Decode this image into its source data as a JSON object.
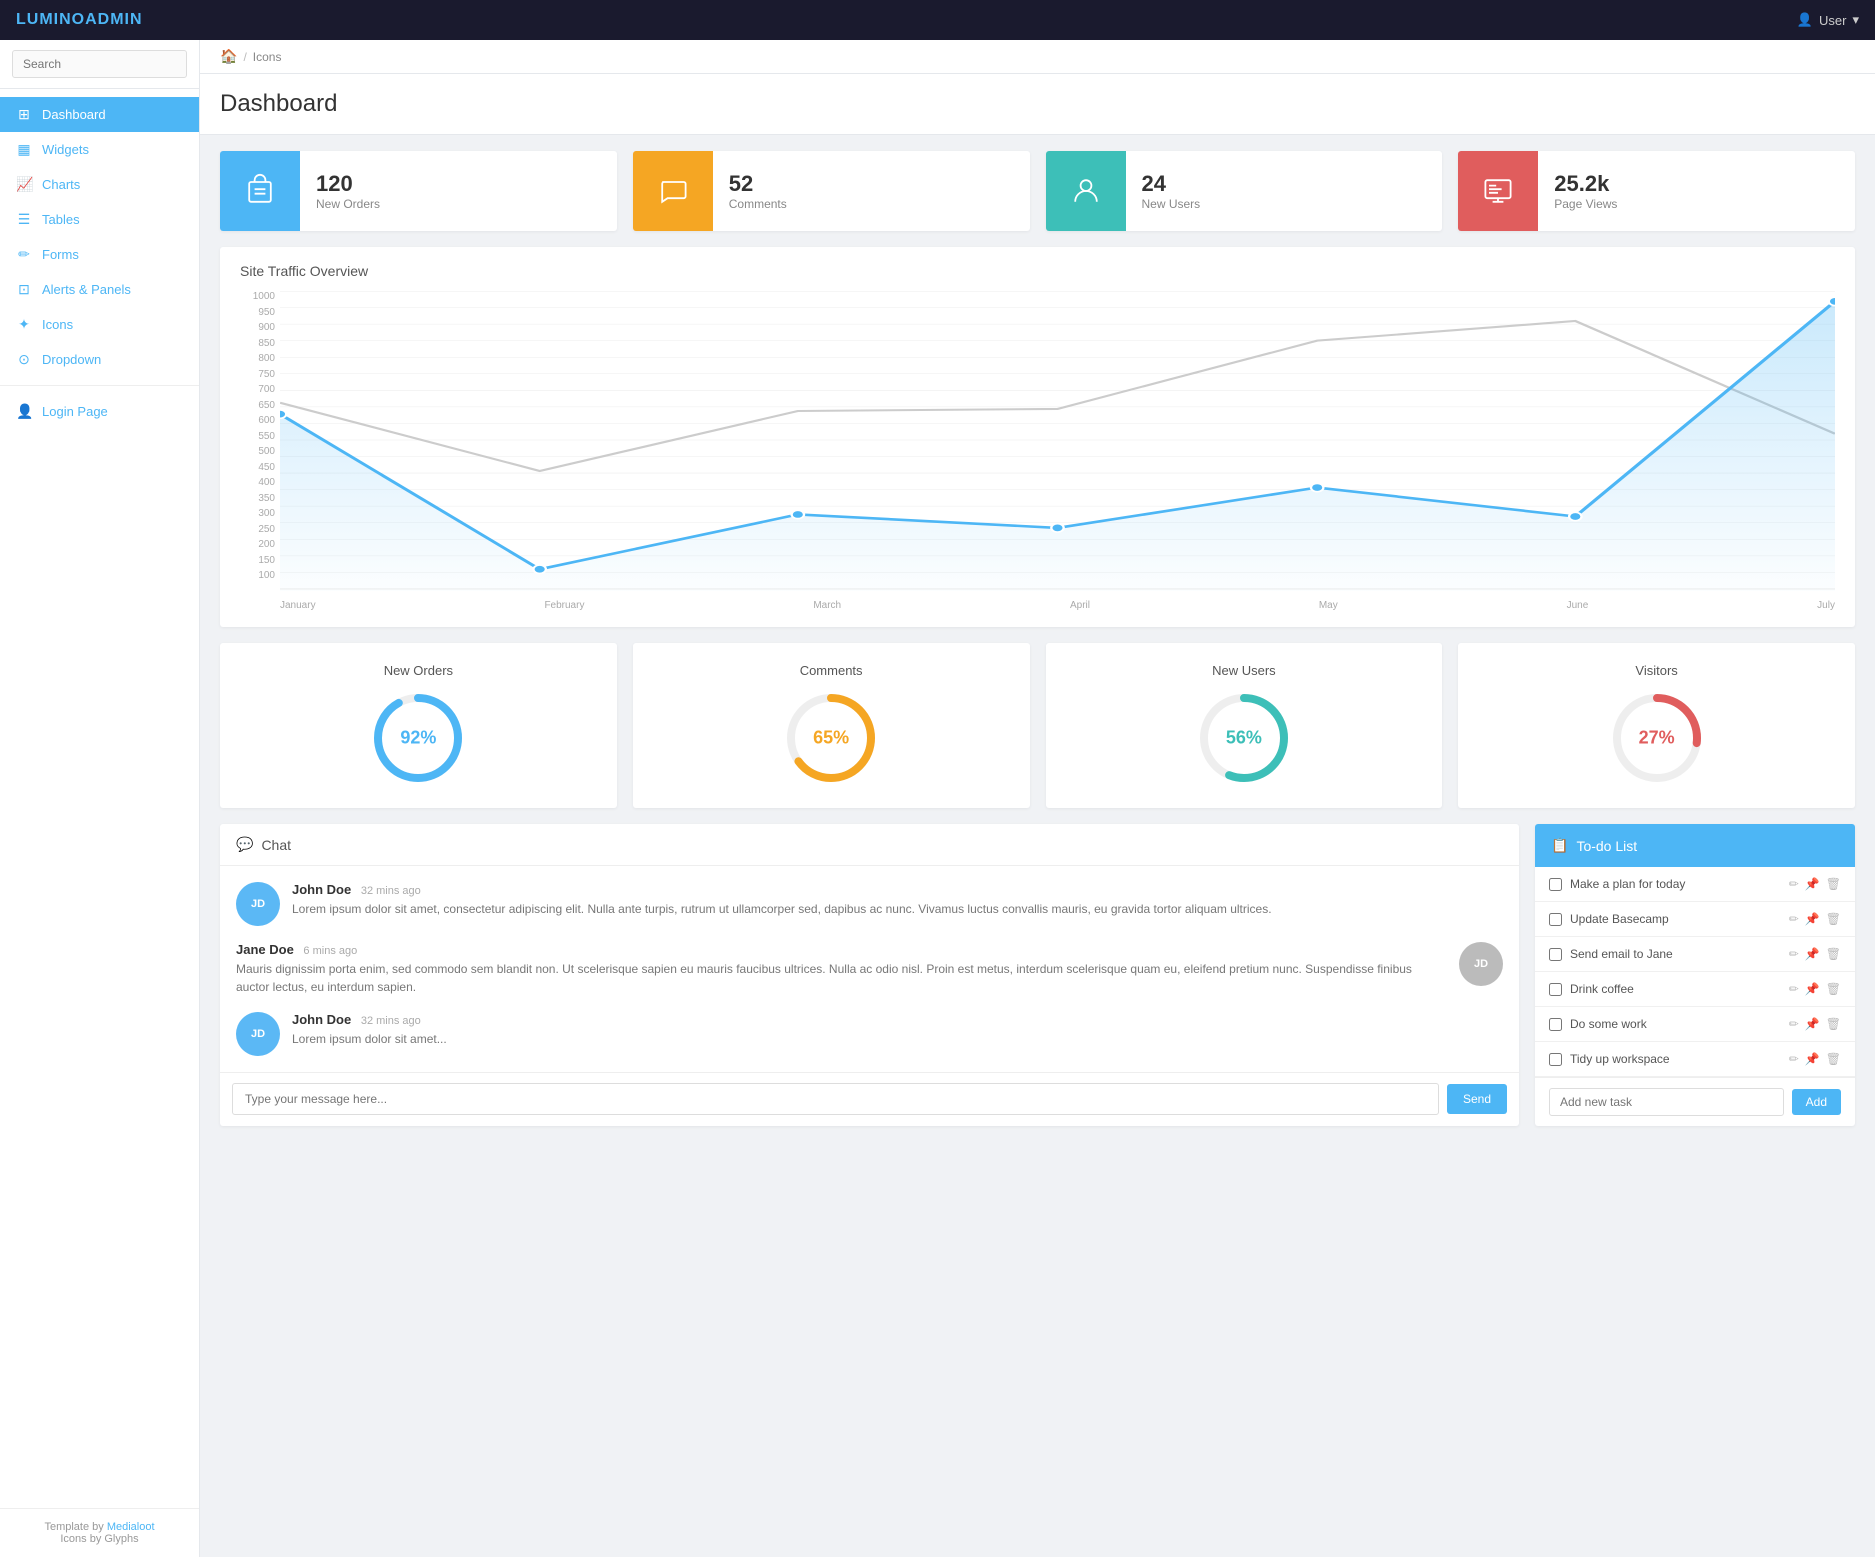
{
  "navbar": {
    "brand_prefix": "LUMINO",
    "brand_suffix": "ADMIN",
    "user_label": "User"
  },
  "sidebar": {
    "search_placeholder": "Search",
    "items": [
      {
        "id": "dashboard",
        "label": "Dashboard",
        "icon": "⊞",
        "active": true
      },
      {
        "id": "widgets",
        "label": "Widgets",
        "icon": "▦"
      },
      {
        "id": "charts",
        "label": "Charts",
        "icon": "📈"
      },
      {
        "id": "tables",
        "label": "Tables",
        "icon": "☰"
      },
      {
        "id": "forms",
        "label": "Forms",
        "icon": "✏"
      },
      {
        "id": "alerts",
        "label": "Alerts & Panels",
        "icon": "⊡"
      },
      {
        "id": "icons",
        "label": "Icons",
        "icon": "✦"
      },
      {
        "id": "dropdown",
        "label": "Dropdown",
        "icon": "⊙"
      }
    ],
    "extra_items": [
      {
        "id": "login",
        "label": "Login Page",
        "icon": "👤"
      }
    ],
    "footer_template": "Template by",
    "footer_brand": "Medialoot",
    "footer_icons": "Icons by Glyphs"
  },
  "breadcrumb": {
    "home_icon": "🏠",
    "current": "Icons"
  },
  "page": {
    "title": "Dashboard"
  },
  "stats": [
    {
      "id": "orders",
      "icon": "🛍",
      "number": "120",
      "label": "New Orders",
      "color": "#4db6f5"
    },
    {
      "id": "comments",
      "icon": "💬",
      "number": "52",
      "label": "Comments",
      "color": "#f5a623"
    },
    {
      "id": "users",
      "icon": "👤",
      "number": "24",
      "label": "New Users",
      "color": "#3dbfb8"
    },
    {
      "id": "views",
      "icon": "🖥",
      "number": "25.2k",
      "label": "Page Views",
      "color": "#e05d5d"
    }
  ],
  "chart": {
    "title": "Site Traffic Overview",
    "y_labels": [
      "1000",
      "950",
      "900",
      "850",
      "800",
      "750",
      "700",
      "650",
      "600",
      "550",
      "500",
      "450",
      "400",
      "350",
      "300",
      "250",
      "200",
      "150",
      "100"
    ],
    "x_labels": [
      "January",
      "February",
      "March",
      "April",
      "May",
      "June",
      "July"
    ]
  },
  "donuts": [
    {
      "id": "orders",
      "title": "New Orders",
      "value": 92,
      "label": "92%",
      "color": "#4db6f5"
    },
    {
      "id": "comments",
      "title": "Comments",
      "value": 65,
      "label": "65%",
      "color": "#f5a623"
    },
    {
      "id": "users",
      "title": "New Users",
      "value": 56,
      "label": "56%",
      "color": "#3dbfb8"
    },
    {
      "id": "visitors",
      "title": "Visitors",
      "value": 27,
      "label": "27%",
      "color": "#e05d5d"
    }
  ],
  "chat": {
    "title": "Chat",
    "messages": [
      {
        "id": 1,
        "name": "John Doe",
        "time": "32 mins ago",
        "avatar_text": "JD",
        "avatar_color": "#5bb8f5",
        "align": "left",
        "text": "Lorem ipsum dolor sit amet, consectetur adipiscing elit. Nulla ante turpis, rutrum ut ullamcorper sed, dapibus ac nunc. Vivamus luctus convallis mauris, eu gravida tortor aliquam ultrices."
      },
      {
        "id": 2,
        "name": "Jane Doe",
        "time": "6 mins ago",
        "avatar_text": "JD",
        "avatar_color": "#bbb",
        "align": "right",
        "text": "Mauris dignissim porta enim, sed commodo sem blandit non. Ut scelerisque sapien eu mauris faucibus ultrices. Nulla ac odio nisl. Proin est metus, interdum scelerisque quam eu, eleifend pretium nunc. Suspendisse finibus auctor lectus, eu interdum sapien."
      },
      {
        "id": 3,
        "name": "John Doe",
        "time": "32 mins ago",
        "avatar_text": "JD",
        "avatar_color": "#5bb8f5",
        "align": "left",
        "text": "Lorem ipsum dolor sit amet..."
      }
    ],
    "input_placeholder": "Type your message here...",
    "send_label": "Send"
  },
  "todo": {
    "title": "To-do List",
    "items": [
      {
        "id": 1,
        "label": "Make a plan for today",
        "checked": false
      },
      {
        "id": 2,
        "label": "Update Basecamp",
        "checked": false
      },
      {
        "id": 3,
        "label": "Send email to Jane",
        "checked": false
      },
      {
        "id": 4,
        "label": "Drink coffee",
        "checked": false
      },
      {
        "id": 5,
        "label": "Do some work",
        "checked": false
      },
      {
        "id": 6,
        "label": "Tidy up workspace",
        "checked": false
      }
    ],
    "add_placeholder": "Add new task",
    "add_label": "Add"
  }
}
